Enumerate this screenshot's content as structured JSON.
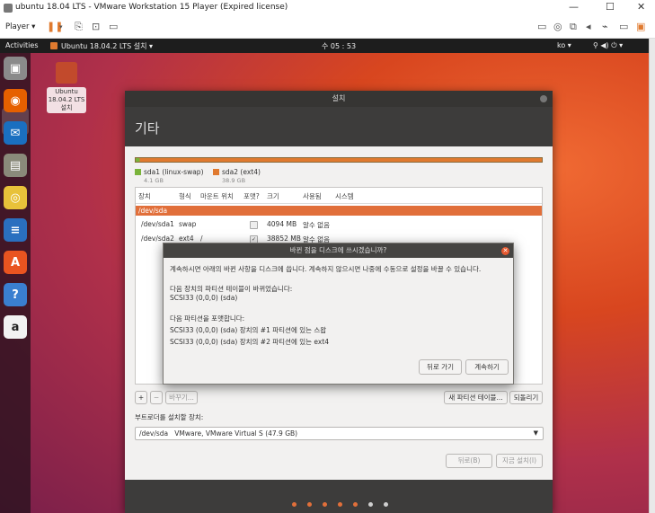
{
  "vmware": {
    "title": "ubuntu 18.04 LTS - VMware Workstation 15 Player (Expired license)",
    "player_menu": "Player ▾",
    "controls": {
      "minimize": "—",
      "maximize": "☐",
      "close": "✕"
    }
  },
  "topbar": {
    "activities": "Activities",
    "app_menu": "Ubuntu 18.04.2 LTS 설치 ▾",
    "clock": "수 05 : 53",
    "input_method": "ko ▾",
    "system_menu": "⚲ ◀) ⏻ ▾"
  },
  "dock": {
    "items": [
      {
        "name": "installer",
        "glyph": "▣",
        "color": "#8a8a8a"
      },
      {
        "name": "firefox",
        "glyph": "◉",
        "color": "#e66000"
      },
      {
        "name": "thunderbird",
        "glyph": "✉",
        "color": "#1a6fc0"
      },
      {
        "name": "files",
        "glyph": "▤",
        "color": "#8a8a7a"
      },
      {
        "name": "rhythmbox",
        "glyph": "◎",
        "color": "#e8c23a"
      },
      {
        "name": "libreoffice-writer",
        "glyph": "≡",
        "color": "#2a6fbf"
      },
      {
        "name": "ubuntu-software",
        "glyph": "A",
        "color": "#e95420"
      },
      {
        "name": "help",
        "glyph": "?",
        "color": "#3a7fd0"
      },
      {
        "name": "amazon",
        "glyph": "a",
        "color": "#f2f2f2"
      }
    ]
  },
  "desktop_icon": {
    "label": "Ubuntu\n18.04.2 LTS\n설치"
  },
  "installer": {
    "window_title": "설치",
    "heading": "기타",
    "legend": [
      {
        "name": "sda1 (linux-swap)",
        "size": "4.1 GB",
        "color": "#7ab33a"
      },
      {
        "name": "sda2 (ext4)",
        "size": "38.9 GB",
        "color": "#e07a2f"
      }
    ],
    "table": {
      "headers": [
        "장치",
        "형식",
        "마운트 위치",
        "포맷?",
        "크기",
        "사용됨",
        "시스템"
      ],
      "device_row": "/dev/sda",
      "rows": [
        {
          "device": "/dev/sda1",
          "type": "swap",
          "mount": "",
          "formatted": false,
          "size": "4094 MB",
          "used": "알수 없음"
        },
        {
          "device": "/dev/sda2",
          "type": "ext4",
          "mount": "/",
          "formatted": true,
          "size": "38852 MB",
          "used": "알수 없음"
        }
      ]
    },
    "buttons": {
      "add": "+",
      "remove": "−",
      "change": "바꾸기...",
      "new_partition_table": "새 파티션 테이블...",
      "revert": "되돌리기",
      "back": "뒤로(B)",
      "install_now": "지금 설치(I)"
    },
    "bootloader_label": "부트로더를 설치할 장치:",
    "bootloader_value": "/dev/sda   VMware, VMware Virtual S (47.9 GB)",
    "progress": {
      "total": 7,
      "current": 5
    }
  },
  "dialog": {
    "title": "바뀐 점을 디스크에 쓰시겠습니까?",
    "intro": "계속하시면 아래의 바뀐 사항을 디스크에 씁니다. 계속하지 않으시면 나중에 수동으로 설정을 바꿀 수 있습니다.",
    "table_changed_label": "다음 장치의 파티션 테이블이 바뀌었습니다:",
    "table_changed_device": "SCSI33 (0,0,0) (sda)",
    "format_label": "다음 파티션을 포맷합니다:",
    "format_items": [
      "SCSI33 (0,0,0) (sda) 장치의 #1 파티션에 있는 스왑",
      "SCSI33 (0,0,0) (sda) 장치의 #2 파티션에 있는 ext4"
    ],
    "back_button": "뒤로 가기",
    "continue_button": "계속하기",
    "close": "✕"
  },
  "colors": {
    "accent": "#e16f3a",
    "ubuntu_orange": "#e95420",
    "dark_header": "#3d3c3b"
  }
}
